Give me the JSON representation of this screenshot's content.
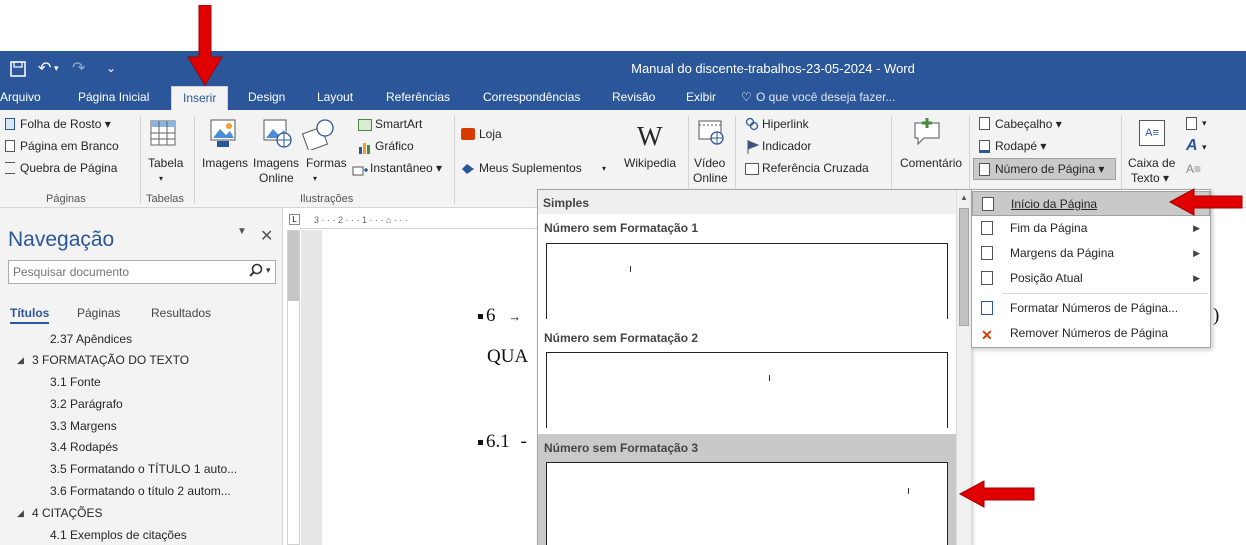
{
  "window": {
    "title": "Manual do discente-trabalhos-23-05-2024 - Word",
    "accent": "#2b579a",
    "qat_undo": "↶",
    "qat_redo": "↷",
    "qat_more": "⌄"
  },
  "ribbon_tabs": [
    "Arquivo",
    "Página Inicial",
    "Inserir",
    "Design",
    "Layout",
    "Referências",
    "Correspondências",
    "Revisão",
    "Exibir"
  ],
  "tell_me": "O que você deseja fazer...",
  "ribbon": {
    "paginas": {
      "label": "Páginas",
      "items": [
        "Folha de Rosto ▾",
        "Página em Branco",
        "Quebra de Página"
      ]
    },
    "tabelas": {
      "label": "Tabelas",
      "button": "Tabela"
    },
    "ilustracoes": {
      "label": "Ilustrações",
      "imagens": "Imagens",
      "imagens_online_1": "Imagens",
      "imagens_online_2": "Online",
      "formas": "Formas",
      "smartart": "SmartArt",
      "grafico": "Gráfico",
      "instantaneo": "Instantâneo ▾"
    },
    "suplementos": {
      "loja": "Loja",
      "meus": "Meus Suplementos",
      "wikipedia": "Wikipedia"
    },
    "midia": {
      "video_1": "Vídeo",
      "video_2": "Online"
    },
    "links": {
      "hiperlink": "Hiperlink",
      "indicador": "Indicador",
      "referencia": "Referência Cruzada"
    },
    "comentarios": {
      "comentario": "Comentário"
    },
    "cabecalho": {
      "cabecalho": "Cabeçalho ▾",
      "rodape": "Rodapé ▾",
      "numero": "Número de Página ▾"
    },
    "texto": {
      "caixa_1": "Caixa de",
      "caixa_2": "Texto ▾"
    }
  },
  "nav": {
    "title": "Navegação",
    "search_placeholder": "Pesquisar documento",
    "tabs": [
      "Títulos",
      "Páginas",
      "Resultados"
    ],
    "items": [
      "2.37 Apêndices",
      "3 FORMATAÇÃO DO TEXTO",
      "3.1 Fonte",
      "3.2 Parágrafo",
      "3.3 Margens",
      "3.4 Rodapés",
      "3.5 Formatando o TÍTULO 1 auto...",
      "3.6 Formatando o título 2 autom...",
      "4 CITAÇÕES",
      "4.1 Exemplos de citações"
    ]
  },
  "document": {
    "line1": "6",
    "line1_arrow": "→",
    "line2": "QUA",
    "line3": "6.1",
    "line3_dash": "-",
    "right_edge": ")"
  },
  "gallery": {
    "header": "Simples",
    "options": [
      "Número sem Formatação 1",
      "Número sem Formatação 2",
      "Número sem Formatação 3"
    ]
  },
  "submenu": {
    "items": [
      "Início da Página",
      "Fim da Página",
      "Margens da Página",
      "Posição Atual",
      "Formatar Números de Página...",
      "Remover Números de Página"
    ]
  }
}
